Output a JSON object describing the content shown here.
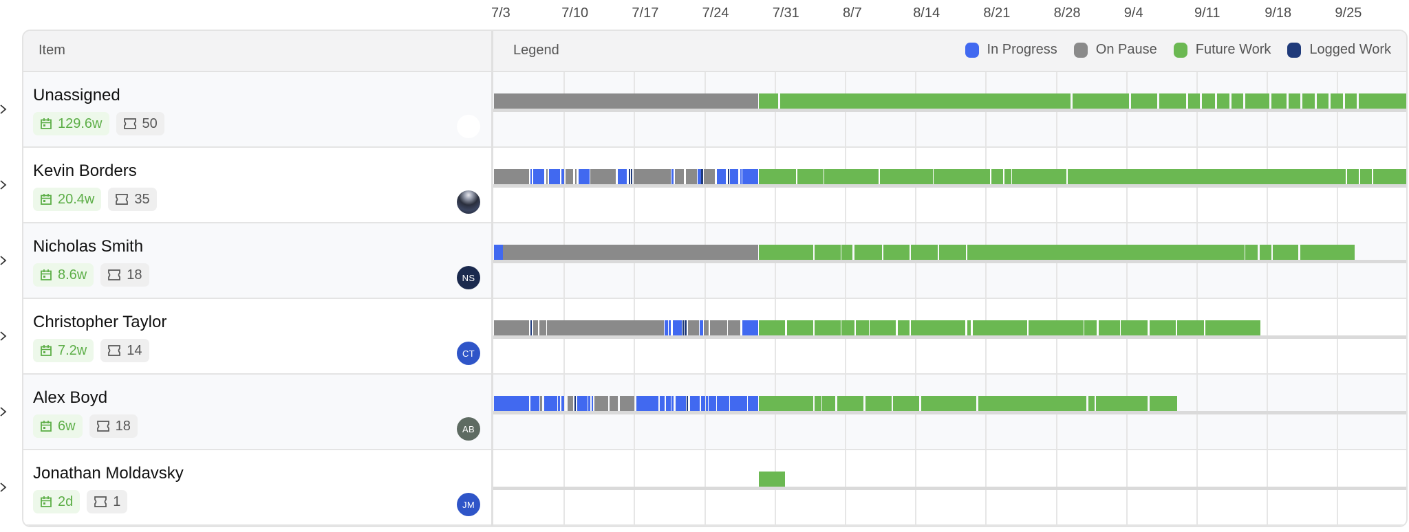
{
  "timeline": {
    "start_date": "7/3",
    "total_days": 91,
    "date_labels": [
      "7/3",
      "7/10",
      "7/17",
      "7/24",
      "7/31",
      "8/7",
      "8/14",
      "8/21",
      "8/28",
      "9/4",
      "9/11",
      "9/18",
      "9/25"
    ]
  },
  "header": {
    "item_label": "Item",
    "legend_label": "Legend"
  },
  "legend": [
    {
      "key": "progress",
      "label": "In Progress",
      "color": "#4169f0"
    },
    {
      "key": "pause",
      "label": "On Pause",
      "color": "#8a8a8a"
    },
    {
      "key": "future",
      "label": "Future Work",
      "color": "#6bb852"
    },
    {
      "key": "logged",
      "label": "Logged Work",
      "color": "#1f3a7a"
    }
  ],
  "rows": [
    {
      "name": "Unassigned",
      "duration": "129.6w",
      "count": "50",
      "avatar": {
        "type": "blank",
        "initials": "",
        "color": "#ffffff"
      },
      "segments": [
        [
          "pause",
          0.0,
          26.3
        ],
        [
          "future",
          26.4,
          28.3
        ],
        [
          "future",
          28.5,
          57.4
        ],
        [
          "future",
          57.6,
          63.2
        ],
        [
          "future",
          63.4,
          66.0
        ],
        [
          "future",
          66.2,
          68.9
        ],
        [
          "future",
          69.1,
          70.3
        ],
        [
          "future",
          70.5,
          71.8
        ],
        [
          "future",
          72.0,
          73.2
        ],
        [
          "future",
          73.4,
          74.6
        ],
        [
          "future",
          74.8,
          77.2
        ],
        [
          "future",
          77.4,
          78.9
        ],
        [
          "future",
          79.1,
          80.3
        ],
        [
          "future",
          80.5,
          81.7
        ],
        [
          "future",
          81.9,
          83.1
        ],
        [
          "future",
          83.3,
          84.5
        ],
        [
          "future",
          84.7,
          85.9
        ],
        [
          "future",
          86.1,
          91.0
        ]
      ]
    },
    {
      "name": "Kevin Borders",
      "duration": "20.4w",
      "count": "35",
      "avatar": {
        "type": "photo",
        "initials": "",
        "color": "#2a2f3d"
      },
      "segments": [
        [
          "pause",
          0.0,
          3.5
        ],
        [
          "progress",
          3.6,
          3.8
        ],
        [
          "progress",
          3.9,
          5.0
        ],
        [
          "pause",
          5.2,
          5.3
        ],
        [
          "progress",
          5.5,
          6.6
        ],
        [
          "progress",
          6.7,
          7.0
        ],
        [
          "pause",
          7.1,
          7.9
        ],
        [
          "pause",
          8.1,
          8.2
        ],
        [
          "progress",
          8.4,
          9.5
        ],
        [
          "pause",
          9.6,
          12.1
        ],
        [
          "progress",
          12.3,
          13.2
        ],
        [
          "logged",
          13.4,
          13.5
        ],
        [
          "logged",
          13.6,
          13.8
        ],
        [
          "pause",
          13.9,
          17.6
        ],
        [
          "progress",
          17.7,
          17.9
        ],
        [
          "pause",
          18.0,
          18.9
        ],
        [
          "pause",
          19.1,
          20.2
        ],
        [
          "progress",
          20.3,
          20.6
        ],
        [
          "logged",
          20.6,
          20.8
        ],
        [
          "pause",
          20.9,
          22.0
        ],
        [
          "progress",
          22.2,
          23.1
        ],
        [
          "logged",
          23.3,
          23.4
        ],
        [
          "progress",
          23.5,
          24.3
        ],
        [
          "progress",
          24.5,
          24.6
        ],
        [
          "progress",
          24.7,
          26.3
        ],
        [
          "future",
          26.4,
          30.1
        ],
        [
          "future",
          30.2,
          32.8
        ],
        [
          "future",
          32.9,
          38.3
        ],
        [
          "future",
          38.4,
          43.7
        ],
        [
          "future",
          43.8,
          49.4
        ],
        [
          "future",
          49.5,
          50.7
        ],
        [
          "future",
          50.8,
          51.5
        ],
        [
          "future",
          51.6,
          57.0
        ],
        [
          "future",
          57.1,
          84.8
        ],
        [
          "future",
          84.9,
          86.1
        ],
        [
          "future",
          86.2,
          87.4
        ],
        [
          "future",
          87.5,
          91.0
        ]
      ]
    },
    {
      "name": "Nicholas Smith",
      "duration": "8.6w",
      "count": "18",
      "avatar": {
        "type": "initials",
        "initials": "NS",
        "color": "#1b2a4e"
      },
      "segments": [
        [
          "progress",
          0.0,
          0.9
        ],
        [
          "pause",
          0.9,
          26.3
        ],
        [
          "future",
          26.4,
          31.8
        ],
        [
          "future",
          31.9,
          34.5
        ],
        [
          "future",
          34.6,
          35.7
        ],
        [
          "future",
          35.9,
          38.6
        ],
        [
          "future",
          38.8,
          41.4
        ],
        [
          "future",
          41.5,
          44.2
        ],
        [
          "future",
          44.3,
          47.0
        ],
        [
          "future",
          47.1,
          74.7
        ],
        [
          "future",
          74.8,
          76.0
        ],
        [
          "future",
          76.2,
          77.4
        ],
        [
          "future",
          77.5,
          80.1
        ],
        [
          "future",
          80.3,
          85.7
        ]
      ]
    },
    {
      "name": "Christopher Taylor",
      "duration": "7.2w",
      "count": "14",
      "avatar": {
        "type": "initials",
        "initials": "CT",
        "color": "#2f55c8"
      },
      "segments": [
        [
          "pause",
          0.0,
          3.5
        ],
        [
          "logged",
          3.6,
          3.8
        ],
        [
          "pause",
          3.9,
          4.4
        ],
        [
          "pause",
          4.5,
          5.2
        ],
        [
          "pause",
          5.3,
          16.9
        ],
        [
          "progress",
          17.0,
          17.3
        ],
        [
          "progress",
          17.4,
          17.6
        ],
        [
          "progress",
          17.8,
          18.7
        ],
        [
          "logged",
          18.8,
          18.9
        ],
        [
          "logged",
          19.0,
          19.2
        ],
        [
          "pause",
          19.3,
          20.4
        ],
        [
          "progress",
          20.5,
          20.8
        ],
        [
          "pause",
          20.9,
          21.4
        ],
        [
          "pause",
          21.5,
          23.2
        ],
        [
          "pause",
          23.3,
          24.5
        ],
        [
          "progress",
          24.7,
          26.3
        ],
        [
          "future",
          26.4,
          29.0
        ],
        [
          "future",
          29.2,
          31.8
        ],
        [
          "future",
          31.9,
          34.5
        ],
        [
          "future",
          34.6,
          35.9
        ],
        [
          "future",
          36.0,
          37.3
        ],
        [
          "future",
          37.4,
          40.0
        ],
        [
          "future",
          40.2,
          41.4
        ],
        [
          "future",
          41.5,
          46.9
        ],
        [
          "future",
          47.1,
          47.5
        ],
        [
          "future",
          47.7,
          53.1
        ],
        [
          "future",
          53.2,
          58.7
        ],
        [
          "future",
          58.8,
          60.0
        ],
        [
          "future",
          60.2,
          62.3
        ],
        [
          "future",
          62.4,
          65.1
        ],
        [
          "future",
          65.3,
          67.9
        ],
        [
          "future",
          68.0,
          70.7
        ],
        [
          "future",
          70.8,
          76.3
        ]
      ]
    },
    {
      "name": "Alex Boyd",
      "duration": "6w",
      "count": "18",
      "avatar": {
        "type": "initials",
        "initials": "AB",
        "color": "#5e6b62"
      },
      "segments": [
        [
          "progress",
          0.0,
          3.5
        ],
        [
          "progress",
          3.6,
          4.5
        ],
        [
          "pause",
          4.6,
          4.8
        ],
        [
          "progress",
          5.0,
          6.3
        ],
        [
          "progress",
          6.4,
          6.6
        ],
        [
          "progress",
          6.7,
          7.0
        ],
        [
          "pause",
          7.3,
          7.9
        ],
        [
          "logged",
          8.0,
          8.1
        ],
        [
          "progress",
          8.3,
          9.3
        ],
        [
          "progress",
          9.4,
          9.6
        ],
        [
          "progress",
          9.7,
          9.8
        ],
        [
          "pause",
          10.0,
          11.4
        ],
        [
          "pause",
          11.5,
          12.3
        ],
        [
          "pause",
          12.5,
          14.0
        ],
        [
          "progress",
          14.2,
          16.4
        ],
        [
          "progress",
          16.5,
          17.0
        ],
        [
          "progress",
          17.1,
          17.6
        ],
        [
          "progress",
          17.7,
          17.9
        ],
        [
          "progress",
          18.1,
          19.1
        ],
        [
          "logged",
          19.2,
          19.3
        ],
        [
          "progress",
          19.5,
          20.5
        ],
        [
          "progress",
          20.6,
          21.0
        ],
        [
          "progress",
          21.1,
          21.3
        ],
        [
          "progress",
          21.4,
          22.1
        ],
        [
          "progress",
          22.2,
          23.4
        ],
        [
          "progress",
          23.5,
          25.2
        ],
        [
          "progress",
          25.3,
          26.3
        ],
        [
          "future",
          26.4,
          31.8
        ],
        [
          "future",
          31.9,
          32.6
        ],
        [
          "future",
          32.7,
          34.0
        ],
        [
          "future",
          34.2,
          36.8
        ],
        [
          "future",
          37.0,
          39.6
        ],
        [
          "future",
          39.7,
          42.3
        ],
        [
          "future",
          42.5,
          48.0
        ],
        [
          "future",
          48.2,
          59.0
        ],
        [
          "future",
          59.2,
          59.8
        ],
        [
          "future",
          59.9,
          65.1
        ],
        [
          "future",
          65.3,
          68.0
        ]
      ]
    },
    {
      "name": "Jonathan Moldavsky",
      "duration": "2d",
      "count": "1",
      "avatar": {
        "type": "initials",
        "initials": "JM",
        "color": "#2f55c8"
      },
      "segments": [
        [
          "future",
          26.4,
          29.0
        ]
      ]
    }
  ]
}
